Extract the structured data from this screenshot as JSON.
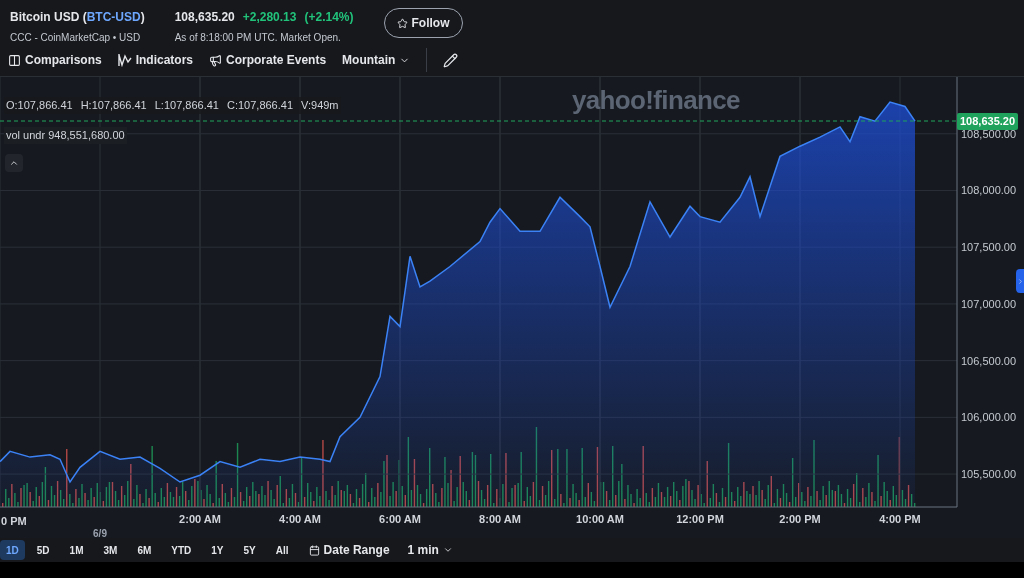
{
  "quote": {
    "name": "Bitcoin USD",
    "symbol": "(BTC-USD)",
    "source": "CCC - CoinMarketCap • USD",
    "price": "108,635.20",
    "change": "+2,280.13",
    "change_pct": "(+2.14%)",
    "as_of": "As of 8:18:00 PM UTC. Market Open.",
    "follow": "Follow"
  },
  "toolbar": [
    {
      "kind": "comparisons",
      "label": "Comparisons"
    },
    {
      "kind": "indicators",
      "label": "Indicators"
    },
    {
      "kind": "events",
      "label": "Corporate Events"
    },
    {
      "kind": "dropdown",
      "label": "Mountain"
    }
  ],
  "legend": {
    "ohlc": [
      "O:107,866.41",
      "H:107,866.41",
      "L:107,866.41",
      "C:107,866.41",
      "V:949m"
    ],
    "vol_label": "vol undr",
    "vol_value": "948,551,680.00"
  },
  "logo": "yahoo!finance",
  "price_tag": {
    "label": "108,635.20",
    "color": "#1fa35c"
  },
  "x_axis_edge_label": "0 PM",
  "chart_data": {
    "type": "area",
    "grid": true,
    "x": [
      -2,
      -1.8,
      -1.4,
      -1,
      -0.8,
      -0.6,
      -0.4,
      0,
      0.4,
      0.8,
      1.2,
      1.6,
      2,
      2.4,
      2.8,
      3.2,
      3.6,
      4,
      4.4,
      4.6,
      4.8,
      5.2,
      5.6,
      5.8,
      6,
      6.2,
      6.4,
      6.6,
      7,
      7.6,
      7.8,
      8,
      8.4,
      8.8,
      9.2,
      9.6,
      9.8,
      10,
      10.2,
      10.6,
      11,
      11.4,
      11.8,
      12,
      12.4,
      12.8,
      13,
      13.2,
      13.6,
      14,
      14.4,
      14.8,
      15,
      15.2,
      15.5,
      15.8,
      16.1,
      16.3
    ],
    "series": [
      {
        "color": "#3b82f6",
        "values": [
          105610,
          105700,
          105650,
          105670,
          105630,
          105430,
          105560,
          105700,
          105630,
          105650,
          105550,
          105430,
          105490,
          105610,
          105560,
          105630,
          105610,
          105650,
          105630,
          105610,
          105830,
          106000,
          106360,
          106890,
          106800,
          107420,
          107150,
          107200,
          107330,
          107550,
          107720,
          107840,
          107640,
          107640,
          107940,
          107770,
          107680,
          107330,
          106970,
          107330,
          107900,
          107590,
          107860,
          107770,
          107720,
          107940,
          108120,
          107770,
          108300,
          108390,
          108470,
          108560,
          108430,
          108650,
          108610,
          108780,
          108740,
          108610
        ]
      }
    ],
    "xlim": [
      -2,
      17.14
    ],
    "ylim": [
      105210,
      109000
    ],
    "xticks": [
      {
        "value": 2,
        "label": "2:00 AM"
      },
      {
        "value": 4,
        "label": "4:00 AM"
      },
      {
        "value": 6,
        "label": "6:00 AM"
      },
      {
        "value": 8,
        "label": "8:00 AM"
      },
      {
        "value": 10,
        "label": "10:00 AM"
      },
      {
        "value": 12,
        "label": "12:00 PM"
      },
      {
        "value": 14,
        "label": "2:00 PM"
      },
      {
        "value": 16,
        "label": "4:00 PM"
      }
    ],
    "yticks": [
      {
        "value": 105500,
        "label": "105,500.00"
      },
      {
        "value": 106000,
        "label": "106,000.00"
      },
      {
        "value": 106500,
        "label": "106,500.00"
      },
      {
        "value": 107000,
        "label": "107,000.00"
      },
      {
        "value": 107500,
        "label": "107,500.00"
      },
      {
        "value": 108000,
        "label": "108,000.00"
      },
      {
        "value": 108500,
        "label": "108,500.00"
      }
    ],
    "annotations": [
      "6/9"
    ]
  },
  "ranges": [
    {
      "label": "1D",
      "selected": true
    },
    {
      "label": "5D",
      "selected": false
    },
    {
      "label": "1M",
      "selected": false
    },
    {
      "label": "3M",
      "selected": false
    },
    {
      "label": "6M",
      "selected": false
    },
    {
      "label": "YTD",
      "selected": false
    },
    {
      "label": "1Y",
      "selected": false
    },
    {
      "label": "5Y",
      "selected": false
    },
    {
      "label": "All",
      "selected": false
    }
  ],
  "date_range": "Date Range",
  "interval": "1 min"
}
